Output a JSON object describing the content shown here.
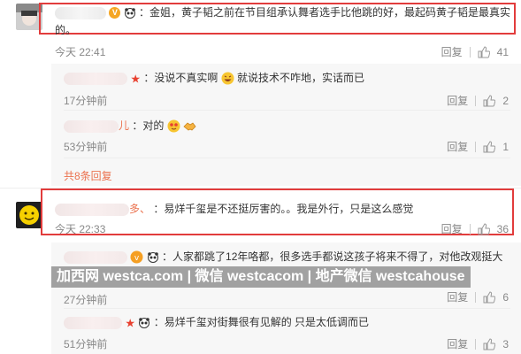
{
  "comment1": {
    "text": "：金姐，黄子韬之前在节目组承认舞者选手比他跳的好，最起码黄子韬是最真实",
    "text_cont": "的。",
    "time": "今天 22:41",
    "reply_label": "回复",
    "likes": "41"
  },
  "reply1": {
    "text": "：没说不真实啊",
    "text2": "就说技术不咋地，实话而已",
    "time": "17分钟前",
    "reply_label": "回复",
    "likes": "2"
  },
  "reply2": {
    "name_tail": "儿",
    "text": "：对的",
    "time": "53分钟前",
    "reply_label": "回复",
    "likes": "1"
  },
  "more_replies": "共8条回复",
  "comment2": {
    "name_tail": "多、",
    "text": "：易烊千玺是不还挺厉害的。。我是外行，只是这么感觉",
    "time": "今天 22:33",
    "reply_label": "回复",
    "likes": "36"
  },
  "reply3": {
    "text": "：人家都跳了12年咯都，很多选手都说这孩子将来不得了，对他改观挺大",
    "time": "27分钟前",
    "reply_label": "回复",
    "likes": "6"
  },
  "reply4": {
    "text": "：易烊千玺对街舞很有见解的   只是太低调而已",
    "time": "51分钟前",
    "reply_label": "回复",
    "likes": "3"
  },
  "watermark": "加西网 westca.com | 微信 westcacom | 地产微信 westcahouse",
  "colors": {
    "highlight": "#e23c3c",
    "link": "#eb7350",
    "meta": "#888888"
  }
}
